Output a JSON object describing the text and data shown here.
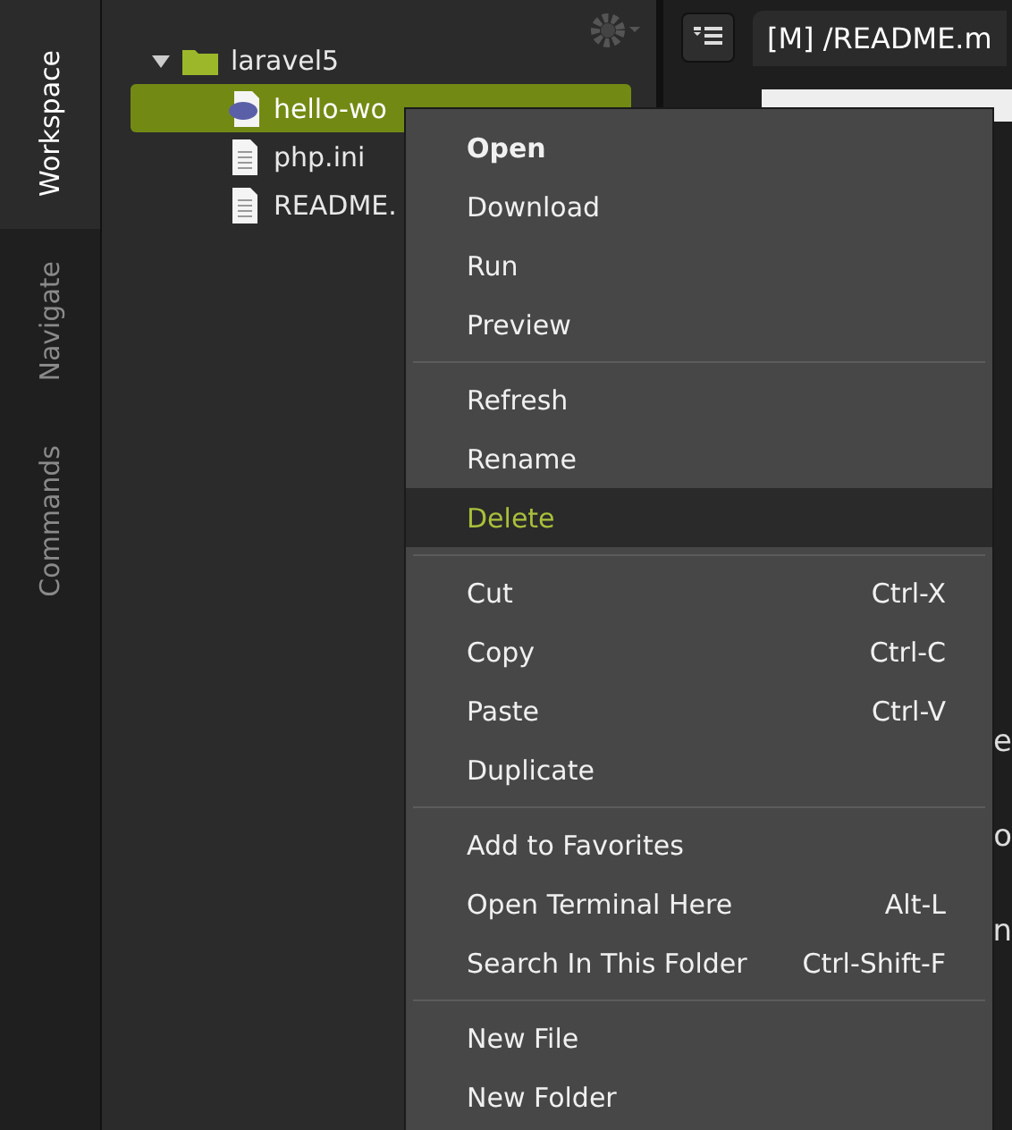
{
  "side_tabs": [
    {
      "label": "Workspace",
      "selected": true
    },
    {
      "label": "Navigate",
      "selected": false
    },
    {
      "label": "Commands",
      "selected": false
    }
  ],
  "tree": [
    {
      "name": "laravel5",
      "kind": "folder",
      "expanded": true,
      "selected": false,
      "children": [
        {
          "name": "hello-wo",
          "kind": "php",
          "selected": true
        },
        {
          "name": "php.ini",
          "kind": "file",
          "selected": false
        },
        {
          "name": "README.",
          "kind": "file",
          "selected": false
        }
      ]
    }
  ],
  "editor": {
    "tab": "[M] /README.m",
    "lines": [
      "e",
      "o",
      "n"
    ]
  },
  "context_menu": [
    {
      "kind": "item",
      "label": "Open",
      "default": true,
      "selected": false
    },
    {
      "kind": "item",
      "label": "Download",
      "default": false,
      "selected": false
    },
    {
      "kind": "item",
      "label": "Run",
      "default": false,
      "selected": false
    },
    {
      "kind": "item",
      "label": "Preview",
      "default": false,
      "selected": false
    },
    {
      "kind": "separator"
    },
    {
      "kind": "item",
      "label": "Refresh",
      "default": false,
      "selected": false
    },
    {
      "kind": "item",
      "label": "Rename",
      "default": false,
      "selected": false
    },
    {
      "kind": "item",
      "label": "Delete",
      "default": false,
      "selected": true
    },
    {
      "kind": "separator"
    },
    {
      "kind": "item",
      "label": "Cut",
      "shortcut": "Ctrl-X",
      "default": false,
      "selected": false
    },
    {
      "kind": "item",
      "label": "Copy",
      "shortcut": "Ctrl-C",
      "default": false,
      "selected": false
    },
    {
      "kind": "item",
      "label": "Paste",
      "shortcut": "Ctrl-V",
      "default": false,
      "selected": false
    },
    {
      "kind": "item",
      "label": "Duplicate",
      "default": false,
      "selected": false
    },
    {
      "kind": "separator"
    },
    {
      "kind": "item",
      "label": "Add to Favorites",
      "default": false,
      "selected": false
    },
    {
      "kind": "item",
      "label": "Open Terminal Here",
      "shortcut": "Alt-L",
      "default": false,
      "selected": false
    },
    {
      "kind": "item",
      "label": "Search In This Folder",
      "shortcut": "Ctrl-Shift-F",
      "default": false,
      "selected": false
    },
    {
      "kind": "separator"
    },
    {
      "kind": "item",
      "label": "New File",
      "default": false,
      "selected": false
    },
    {
      "kind": "item",
      "label": "New Folder",
      "default": false,
      "selected": false
    }
  ]
}
